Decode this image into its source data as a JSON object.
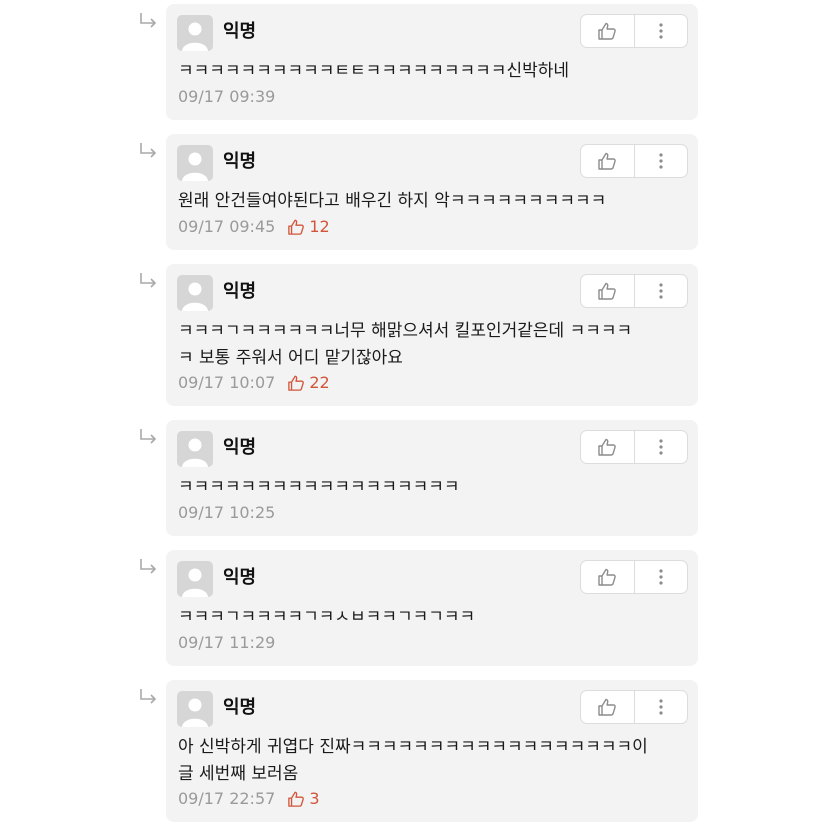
{
  "comments": [
    {
      "author": "익명",
      "text": "ㅋㅋㅋㅋㅋㅋㅋㅋㅋㅋㅌㅌㅋㅋㅋㅋㅋㅋㅋㅋㅋ신박하네",
      "time": "09/17 09:39",
      "likes": ""
    },
    {
      "author": "익명",
      "text": "원래 안건들여야된다고 배우긴 하지 악ㅋㅋㅋㅋㅋㅋㅋㅋㅋㅋ",
      "time": "09/17 09:45",
      "likes": "12"
    },
    {
      "author": "익명",
      "text": "ㅋㅋㅋㄱㅋㅋㅋㅋㅋㅋ너무 해맑으셔서 킬포인거같은데 ㅋㅋㅋㅋ\nㅋ 보통 주워서 어디 맡기잖아요",
      "time": "09/17 10:07",
      "likes": "22"
    },
    {
      "author": "익명",
      "text": "ㅋㅋㅋㅋㅋㅋㅋㅋㅋㅋㅋㅋㅋㅋㅋㅋㅋㅋ",
      "time": "09/17 10:25",
      "likes": ""
    },
    {
      "author": "익명",
      "text": "ㅋㅋㅋㄱㅋㅋㅋㅋㄱㅋㅅㅂㅋㅋㄱㅋㄱㅋㅋ",
      "time": "09/17 11:29",
      "likes": ""
    },
    {
      "author": "익명",
      "text": "아 신박하게 귀엽다 진짜ㅋㅋㅋㅋㅋㅋㅋㅋㅋㅋㅋㅋㅋㅋㅋㅋㅋㅋ이\n글 세번째 보러옴",
      "time": "09/17 22:57",
      "likes": "3"
    }
  ],
  "icons": {
    "reply": "reply-arrow-icon",
    "like": "thumbs-up-icon",
    "more": "more-vertical-icon",
    "avatar": "default-avatar-icon"
  },
  "colors": {
    "card_bg": "#f3f3f3",
    "like_count": "#d2553a",
    "meta_text": "#9a9a9a"
  }
}
